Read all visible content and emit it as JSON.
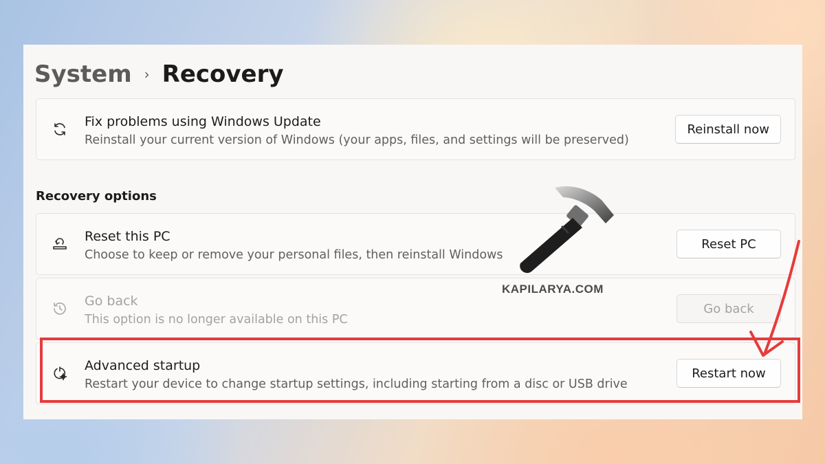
{
  "breadcrumb": {
    "parent": "System",
    "separator": "›",
    "current": "Recovery"
  },
  "cards": {
    "fix_problems": {
      "icon": "refresh-icon",
      "title": "Fix problems using Windows Update",
      "description": "Reinstall your current version of Windows (your apps, files, and settings will be preserved)",
      "button": "Reinstall now"
    },
    "reset_pc": {
      "icon": "reset-pc-icon",
      "title": "Reset this PC",
      "description": "Choose to keep or remove your personal files, then reinstall Windows",
      "button": "Reset PC"
    },
    "go_back": {
      "icon": "history-icon",
      "title": "Go back",
      "description": "This option is no longer available on this PC",
      "button": "Go back",
      "disabled": true
    },
    "advanced_startup": {
      "icon": "advanced-startup-icon",
      "title": "Advanced startup",
      "description": "Restart your device to change startup settings, including starting from a disc or USB drive",
      "button": "Restart now"
    }
  },
  "section_label": "Recovery options",
  "watermark": {
    "text": "KAPILARYA.COM",
    "icon": "hammer-icon"
  },
  "annotation": {
    "highlight_color": "#e63b3b"
  }
}
